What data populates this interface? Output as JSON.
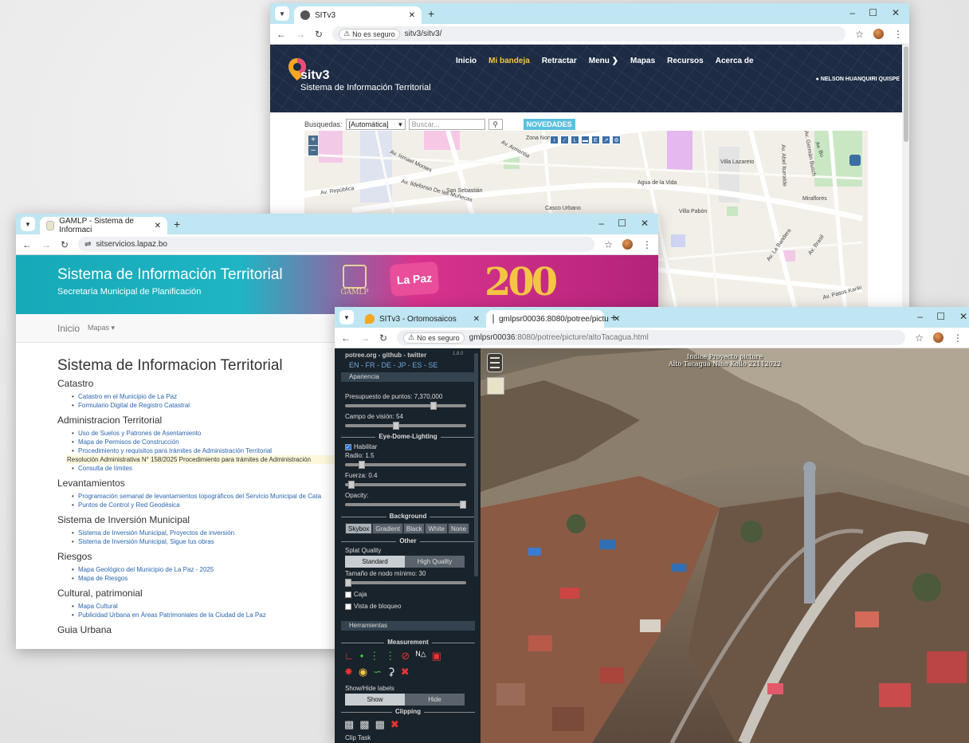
{
  "sitv3_window": {
    "tab_title": "SITv3",
    "not_secure": "No es seguro",
    "url": "sitv3/sitv3/",
    "logo_name": "sitv3",
    "subtitle": "Sistema de Información Territorial",
    "nav": [
      "Inicio",
      "Mi bandeja",
      "Retractar",
      "Menu",
      "Mapas",
      "Recursos",
      "Acerca de"
    ],
    "user": "NELSON HUANQUIRI QUISPE",
    "search_label": "Busquedas:",
    "search_mode": "[Automática]",
    "search_placeholder": "Buscar...",
    "news_button": "NOVEDADES",
    "map_labels": [
      "Zona Norte",
      "Av. Armentia",
      "Av. Ismael Montes",
      "Av. República",
      "Av. Ildefonso De las Muñecas",
      "San Sebastián",
      "Casco Urbano",
      "Agua de la Vida",
      "Villa Lazareto",
      "Villa Pabón",
      "Miraflores",
      "Av. Pasos Kanki",
      "Av. La Bandera",
      "Av. Germán Busch",
      "Av. Brasil",
      "Av. Abel Iturralde",
      "Av. Bu"
    ]
  },
  "gamlp_window": {
    "tab_title": "GAMLP - Sistema de Informaci",
    "url": "sitservicios.lapaz.bo",
    "banner_title": "Sistema de Información Territorial",
    "banner_subtitle": "Secretaría Municipal de Planificación",
    "logo_gamlp": "GAMLP",
    "logo_lapaz": "La Paz",
    "logo_200": "200",
    "nav_home": "Inicio",
    "nav_maps": "Mapas",
    "page_title": "Sistema de Informacion Territorial",
    "sections": [
      {
        "title": "Catastro",
        "items": [
          "Catastro en el Municipio de La Paz",
          "Formulario Digital de Registro Catastral"
        ]
      },
      {
        "title": "Administracion Territorial",
        "items": [
          "Uso de Suelos y Patrones de Asentamiento",
          "Mapa de Permisos de Construcción",
          "Procedimiento y requisitos para trámites de Administración Territorial"
        ],
        "highlight": "Resolución Administrativa N° 158/2025 Procedimiento para trámites de Administración",
        "after": [
          "Consulta de límites"
        ]
      },
      {
        "title": "Levantamientos",
        "items": [
          "Programación semanal de levantamientos topográficos del Servicio Municipal de Cata",
          "Puntos de Control y Red Geodésica"
        ]
      },
      {
        "title": "Sistema de Inversión Municipal",
        "items": [
          "Sistema de Inversión Municipal, Proyectos de inversión",
          "Sistema de Inversión Municipal, Sigue tus obras"
        ]
      },
      {
        "title": "Riesgos",
        "items": [
          "Mapa Geológico del Municipio de La Paz - 2025",
          "Mapa de Riesgos"
        ]
      },
      {
        "title": "Cultural, patrimonial",
        "items": [
          "Mapa Cultural",
          "Publicidad Urbana en Áreas Patrimoniales de la Ciudad de La Paz"
        ]
      },
      {
        "title": "Guia Urbana",
        "items": []
      }
    ]
  },
  "potree_window": {
    "tab1_title": "SITv3 - Ortomosaicos",
    "tab2_title": "gmlpsr00036:8080/potree/pictu",
    "not_secure": "No es seguro",
    "url_host": "gmlpsr00036",
    "url_path": ":8080/potree/picture/altoTacagua.html",
    "links": "potree.org - github - twitter",
    "version": "1.8.0",
    "langs": "EN - FR - DE - JP - ES - SE",
    "apariencia": "Apariencia",
    "budget": "Presupuesto de puntos: 7,370,000",
    "budget_level": 0.73,
    "fov": "Campo de visión: 54",
    "fov_level": 0.42,
    "edl_header": "Eye-Dome-Lighting",
    "habilitar": "Habilitar",
    "radio": "Radio: 1.5",
    "radio_level": 0.14,
    "fuerza": "Fuerza: 0.4",
    "fuerza_level": 0.05,
    "opacity": "Opacity:",
    "opacity_level": 1.0,
    "background_header": "Background",
    "backgrounds": [
      "Skybox",
      "Gradient",
      "Black",
      "White",
      "None"
    ],
    "other_header": "Other",
    "splat": "Splat Quality",
    "standard": "Standard",
    "high": "High Quality",
    "node_size": "Tamaño de nodo mínimo: 30",
    "node_level": 0.02,
    "caja": "Caja",
    "bloqueo": "Vista de bloqueo",
    "herramientas": "Herramientas",
    "measurement_header": "Measurement",
    "showhide": "Show/Hide labels",
    "show": "Show",
    "hide": "Hide",
    "clipping_header": "Clipping",
    "cliptask": "Clip Task",
    "viewport_title_1": "Indice  Proyecto picture",
    "viewport_title_2": "Alto Tacagua Niño Kollo 22112022"
  }
}
